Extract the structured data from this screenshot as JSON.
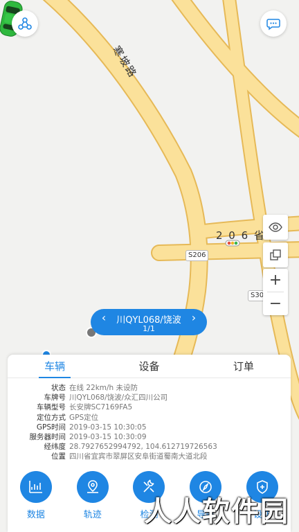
{
  "map": {
    "road_label_1": "寒坡路",
    "road_label_2": "2 0 6 省",
    "shield_1": "S206",
    "shield_2": "S30"
  },
  "vehicle_bubble": {
    "prev": "‹",
    "plate": "川QYL068/饶波",
    "next": "›",
    "page": "1/1"
  },
  "tabs": [
    "车辆",
    "设备",
    "订单"
  ],
  "details": [
    {
      "key": "状态",
      "value": "在线 22km/h 未设防"
    },
    {
      "key": "车牌号",
      "value": "川QYL068/饶波/众汇四川公司"
    },
    {
      "key": "车辆型号",
      "value": "长安牌SC7169FA5"
    },
    {
      "key": "定位方式",
      "value": "GPS定位"
    },
    {
      "key": "GPS时间",
      "value": "2019-03-15 10:30:05"
    },
    {
      "key": "服务器时间",
      "value": "2019-03-15 10:30:09"
    },
    {
      "key": "经纬度",
      "value": "28.7927652994792, 104.612719726563"
    },
    {
      "key": "位置",
      "value": "四川省宜宾市翠屏区安阜街道蜀南大道北段"
    }
  ],
  "actions": [
    {
      "label": "数据",
      "icon": "chart-icon"
    },
    {
      "label": "轨迹",
      "icon": "route-icon"
    },
    {
      "label": "检测",
      "icon": "tools-icon"
    },
    {
      "label": "导航",
      "icon": "compass-icon"
    },
    {
      "label": "设防",
      "icon": "shield-icon"
    }
  ],
  "watermark": "人人软件园",
  "colors": {
    "accent": "#1f86e3",
    "road": "#fbe19a",
    "road_edge": "#e6b957",
    "car": "#2fb83e"
  }
}
